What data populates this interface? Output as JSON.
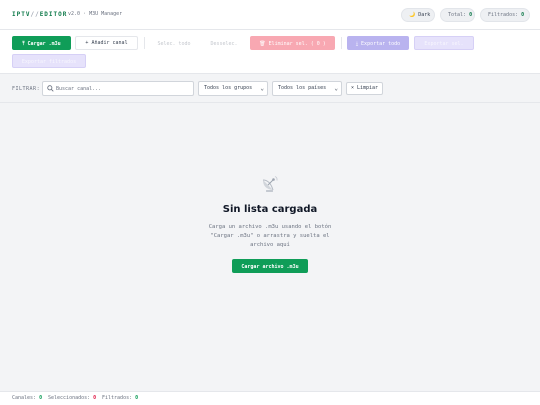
{
  "header": {
    "brand_left": "IPTV",
    "brand_sep": "//",
    "brand_right": "EDITOR",
    "version": "v2.0 · M3U Manager",
    "dark_label": "Dark",
    "total_label": "Total:",
    "total_value": "0",
    "filtered_label": "Filtrados:",
    "filtered_value": "0"
  },
  "toolbar": {
    "load_label": "Cargar .m3u",
    "add_label": "Añadir canal",
    "select_all_label": "Selec. todo",
    "deselect_label": "Desselec.",
    "delete_label": "Eliminar sel. ( 0 )",
    "export_all_label": "Exportar todo",
    "export_sel_label": "Exportar sel.",
    "export_filtered_label": "Exportar filtrados"
  },
  "filter": {
    "label": "FILTRAR:",
    "search_placeholder": "Buscar canal...",
    "groups_selected": "Todos los grupos",
    "countries_selected": "Todos los países",
    "clear_label": "Limpiar"
  },
  "empty": {
    "title": "Sin lista cargada",
    "desc_line1": "Carga un archivo .m3u usando el botón",
    "desc_line2": "\"Cargar .m3u\" o arrastra y suelta el",
    "desc_line3": "archivo aquí",
    "button_label": "Cargar archivo .m3u"
  },
  "status": {
    "channels_label": "Canales:",
    "channels_value": "0",
    "selected_label": "Seleccionados:",
    "selected_value": "0",
    "filtered_label": "Filtrados:",
    "filtered_value": "0"
  },
  "colors": {
    "accent": "#0f9d58",
    "danger": "#f8a8b2",
    "export": "#b9b3ef"
  }
}
